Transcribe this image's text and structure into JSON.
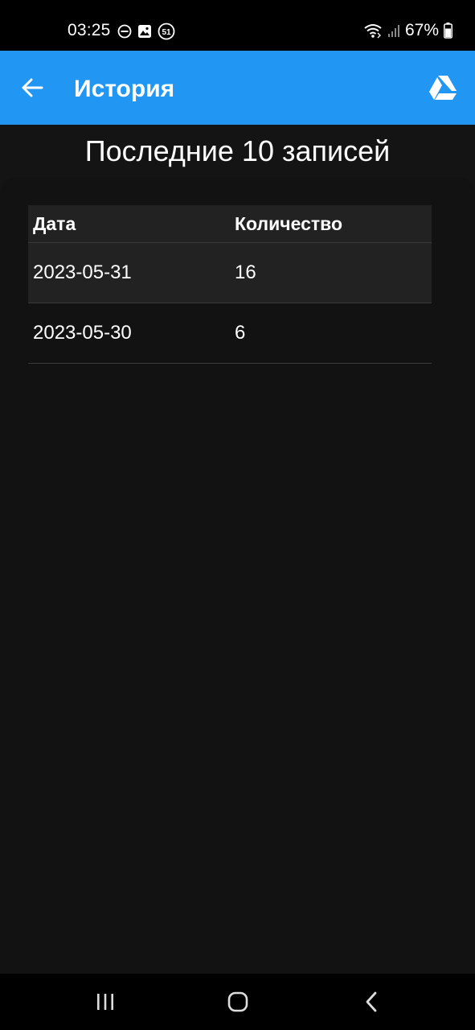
{
  "status_bar": {
    "time": "03:25",
    "battery_percent": "67%",
    "icons_left": [
      "do-not-disturb-icon",
      "gallery-icon",
      "notification-count-icon"
    ],
    "notification_count": "51",
    "icons_right": [
      "wifi-icon",
      "signal-icon",
      "battery-icon"
    ]
  },
  "app_bar": {
    "title": "История",
    "back_icon": "arrow-left-icon",
    "action_icon": "google-drive-icon",
    "color": "#2196f3"
  },
  "heading": "Последние 10 записей",
  "table": {
    "columns": [
      "Дата",
      "Количество"
    ],
    "rows": [
      {
        "date": "2023-05-31",
        "quantity": "16"
      },
      {
        "date": "2023-05-30",
        "quantity": "6"
      }
    ]
  },
  "nav_bar": {
    "buttons": [
      "recent-apps-icon",
      "home-icon",
      "back-icon"
    ]
  }
}
